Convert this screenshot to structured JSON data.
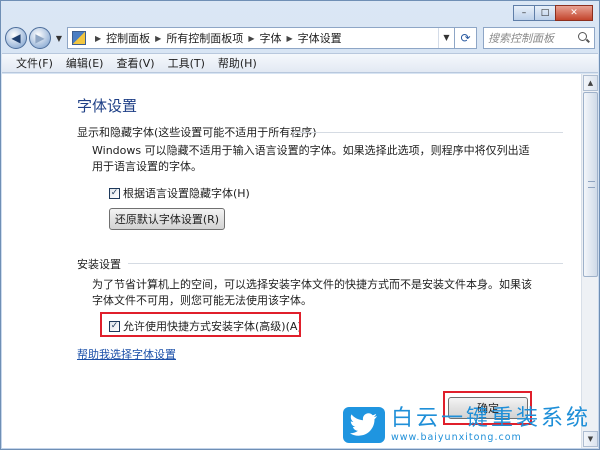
{
  "window": {
    "caption_buttons": {
      "minimize": "–",
      "maximize": "□",
      "close": "✕"
    }
  },
  "nav": {
    "back_icon": "arrow-left",
    "forward_icon": "arrow-right",
    "breadcrumb": [
      "控制面板",
      "所有控制面板项",
      "字体",
      "字体设置"
    ],
    "search_placeholder": "搜索控制面板"
  },
  "menubar": [
    "文件(F)",
    "编辑(E)",
    "查看(V)",
    "工具(T)",
    "帮助(H)"
  ],
  "main": {
    "title": "字体设置",
    "show_hide": {
      "heading": "显示和隐藏字体(这些设置可能不适用于所有程序)",
      "description": "Windows 可以隐藏不适用于输入语言设置的字体。如果选择此选项，则程序中将仅列出适用于语言设置的字体。",
      "checkbox_label": "根据语言设置隐藏字体(H)",
      "checkbox_checked": true,
      "restore_button": "还原默认字体设置(R)"
    },
    "install": {
      "heading": "安装设置",
      "description": "为了节省计算机上的空间，可以选择安装字体文件的快捷方式而不是安装文件本身。如果该字体文件不可用，则您可能无法使用该字体。",
      "checkbox_label": "允许使用快捷方式安装字体(高级)(A)",
      "checkbox_checked": true
    },
    "help_link": "帮助我选择字体设置",
    "ok_button": "确定"
  },
  "watermark": {
    "title": "白云一键重装系统",
    "url": "www.baiyunxitong.com"
  },
  "colors": {
    "highlight": "#e01f2b",
    "title_blue": "#1e3f86",
    "link_blue": "#1a4fa8",
    "watermark_blue": "#1f8fd8"
  }
}
